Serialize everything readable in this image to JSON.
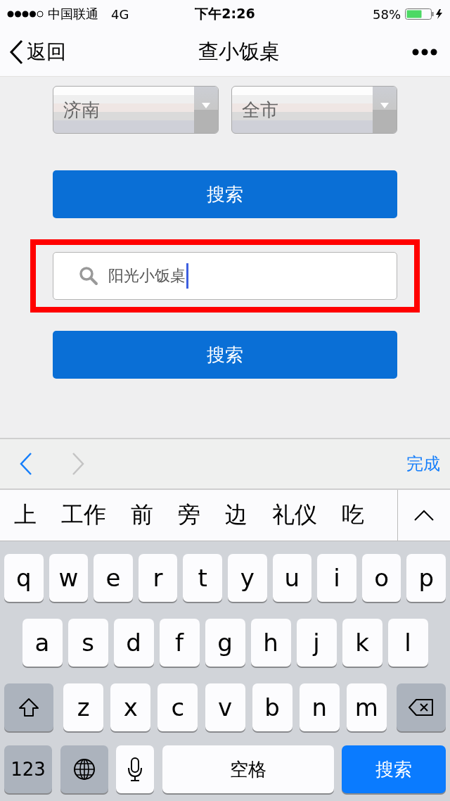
{
  "status_bar": {
    "carrier": "中国联通",
    "network": "4G",
    "time": "下午2:26",
    "battery": "58%"
  },
  "nav_bar": {
    "back": "返回",
    "title": "查小饭桌"
  },
  "selects": [
    {
      "value": "济南"
    },
    {
      "value": "全市"
    }
  ],
  "buttons_top": {
    "label": "搜索"
  },
  "search": {
    "value": "阳光小饭桌",
    "highlighted": true
  },
  "buttons_bottom": {
    "label": "搜索"
  },
  "accessory_bar": {
    "prev_enabled": true,
    "next_enabled": false,
    "done": "完成"
  },
  "candidates": [
    "上",
    "工作",
    "前",
    "旁",
    "边",
    "礼仪",
    "吃"
  ],
  "keyboard": [
    [
      {
        "kind": "letter",
        "label": "q"
      },
      {
        "kind": "letter",
        "label": "w"
      },
      {
        "kind": "letter",
        "label": "e"
      },
      {
        "kind": "letter",
        "label": "r"
      },
      {
        "kind": "letter",
        "label": "t"
      },
      {
        "kind": "letter",
        "label": "y"
      },
      {
        "kind": "letter",
        "label": "u"
      },
      {
        "kind": "letter",
        "label": "i"
      },
      {
        "kind": "letter",
        "label": "o"
      },
      {
        "kind": "letter",
        "label": "p"
      }
    ],
    [
      {
        "kind": "letter",
        "label": "a"
      },
      {
        "kind": "letter",
        "label": "s"
      },
      {
        "kind": "letter",
        "label": "d"
      },
      {
        "kind": "letter",
        "label": "f"
      },
      {
        "kind": "letter",
        "label": "g"
      },
      {
        "kind": "letter",
        "label": "h"
      },
      {
        "kind": "letter",
        "label": "j"
      },
      {
        "kind": "letter",
        "label": "k"
      },
      {
        "kind": "letter",
        "label": "l"
      }
    ],
    [
      {
        "kind": "shift"
      },
      {
        "kind": "letter",
        "label": "z"
      },
      {
        "kind": "letter",
        "label": "x"
      },
      {
        "kind": "letter",
        "label": "c"
      },
      {
        "kind": "letter",
        "label": "v"
      },
      {
        "kind": "letter",
        "label": "b"
      },
      {
        "kind": "letter",
        "label": "n"
      },
      {
        "kind": "letter",
        "label": "m"
      },
      {
        "kind": "delete"
      }
    ],
    [
      {
        "kind": "numbers",
        "label": "123"
      },
      {
        "kind": "globe"
      },
      {
        "kind": "mic"
      },
      {
        "kind": "space",
        "label": "空格"
      },
      {
        "kind": "action",
        "label": "搜索"
      }
    ]
  ]
}
